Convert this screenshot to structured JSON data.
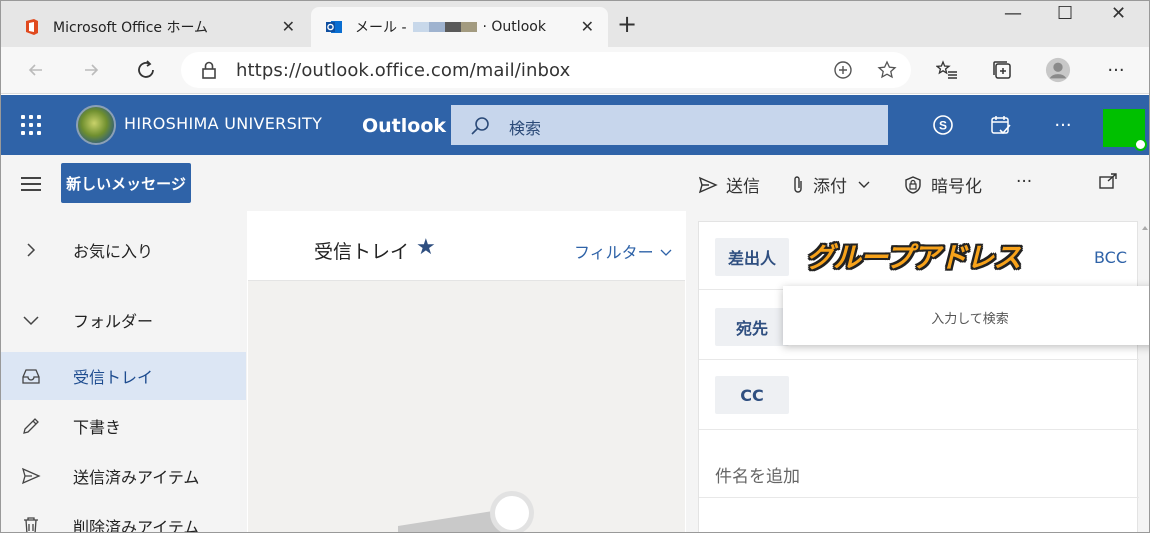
{
  "browser": {
    "tabs": [
      {
        "title": "Microsoft Office ホーム",
        "close": "✕"
      },
      {
        "title_prefix": "メール - ",
        "title_suffix": "· Outlook",
        "close": "✕"
      }
    ],
    "new_tab": "+",
    "url": "https://outlook.office.com/mail/inbox",
    "window_controls": {
      "minimize": "—",
      "maximize": "☐",
      "close": "✕"
    },
    "more": "···"
  },
  "outlook": {
    "org": "HIROSHIMA UNIVERSITY",
    "app": "Outlook",
    "search_placeholder": "検索",
    "more": "···"
  },
  "commands": {
    "new_message": "新しいメッセージ",
    "send": "送信",
    "attach": "添付",
    "encrypt": "暗号化",
    "more": "···"
  },
  "nav": {
    "favorites": "お気に入り",
    "folders": "フォルダー",
    "items": [
      {
        "label": "受信トレイ",
        "selected": true
      },
      {
        "label": "下書き"
      },
      {
        "label": "送信済みアイテム"
      },
      {
        "label": "削除済みアイテム"
      }
    ]
  },
  "list": {
    "title": "受信トレイ",
    "filter": "フィルター"
  },
  "compose": {
    "from_label": "差出人",
    "from_annotation": "グループアドレス",
    "bcc": "BCC",
    "to_label": "宛先",
    "suggest_text": "入力して検索",
    "cc_label": "CC",
    "subject_placeholder": "件名を追加"
  },
  "colors": {
    "brand": "#2f63a8",
    "nav_selected": "#dce6f4",
    "annotation": "#f7a21a",
    "avatar": "#00c000"
  }
}
